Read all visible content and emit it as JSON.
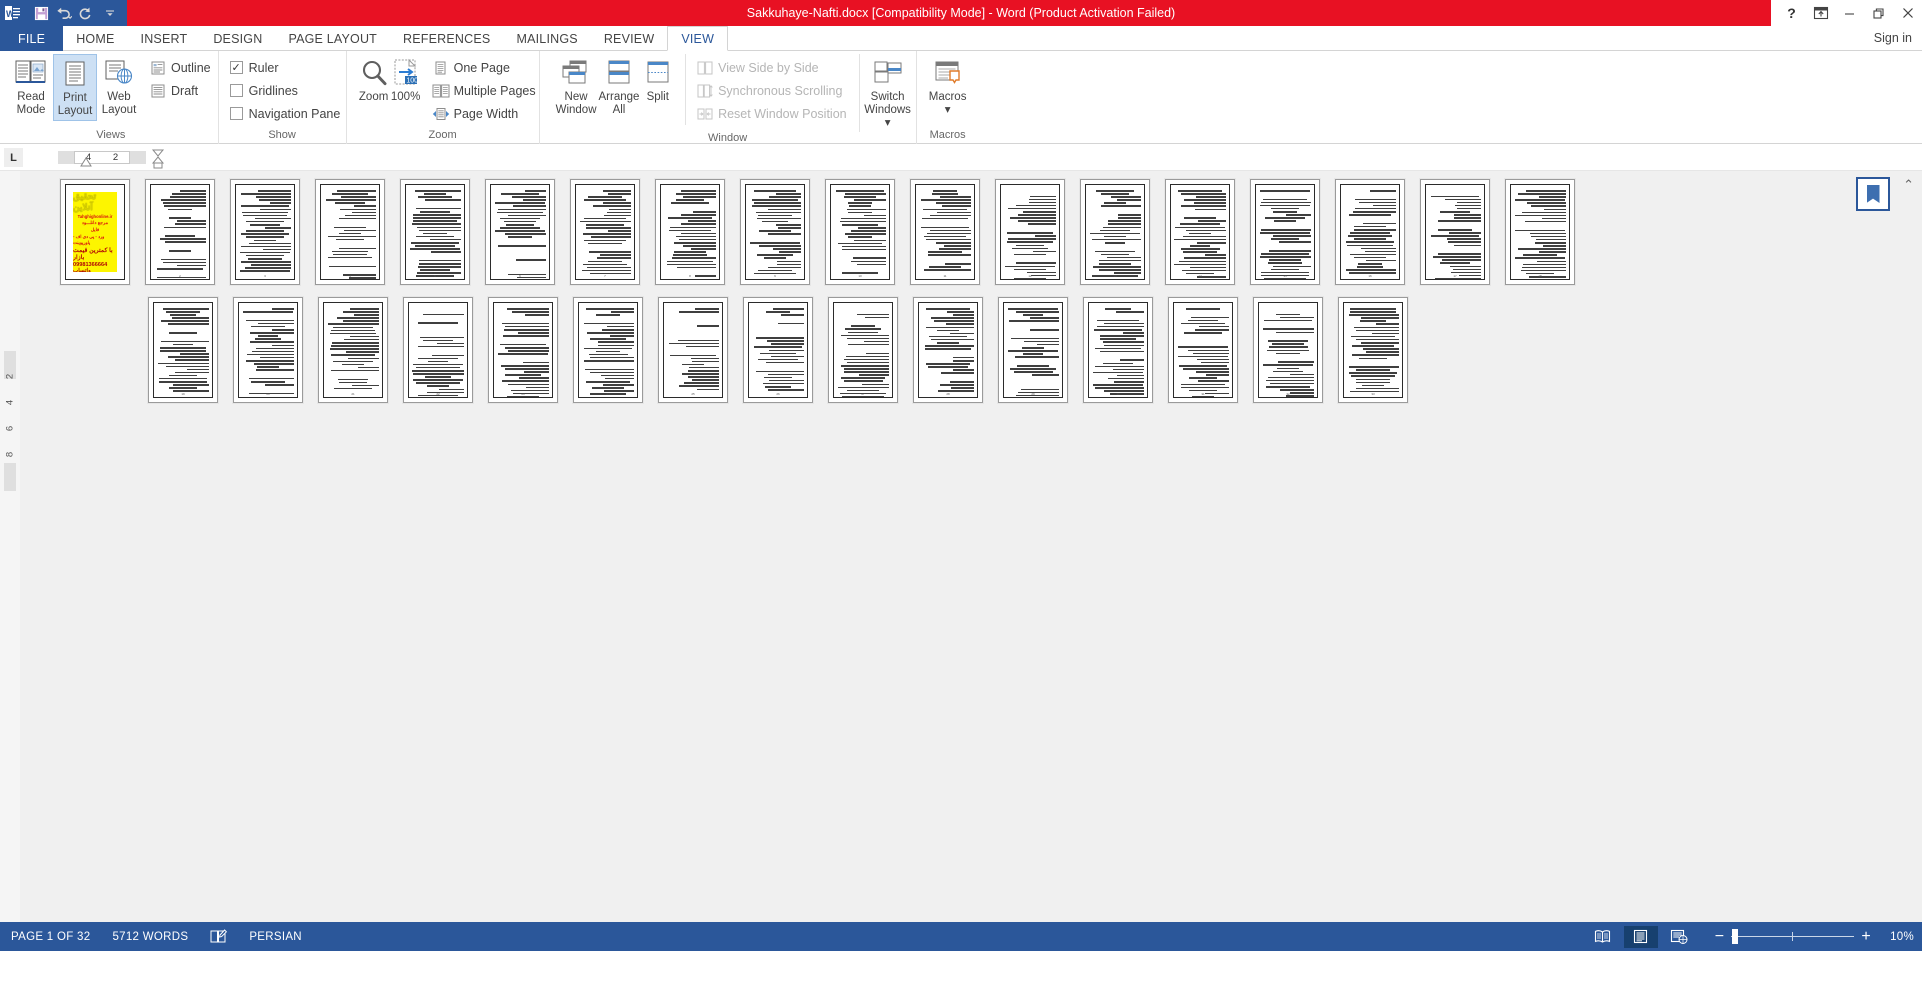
{
  "titlebar": {
    "document_title": "Sakkuhaye-Nafti.docx [Compatibility Mode]  -  Word (Product Activation Failed)",
    "accent_color": "#e81123",
    "quick_access": [
      {
        "name": "save-button",
        "label": "Save",
        "icon": "save-icon"
      },
      {
        "name": "undo-button",
        "label": "Undo",
        "icon": "undo-icon"
      },
      {
        "name": "redo-button",
        "label": "Redo",
        "icon": "redo-icon"
      },
      {
        "name": "customize-qat-button",
        "label": "Customize Quick Access Toolbar",
        "icon": "chevron-down-icon"
      }
    ],
    "window_controls": {
      "help": "?",
      "ribbon_display_options": "Ribbon Display Options",
      "minimize": "Minimize",
      "restore": "Restore Down",
      "close": "Close"
    }
  },
  "tabs": {
    "file_label": "FILE",
    "items": [
      {
        "label": "HOME",
        "active": false
      },
      {
        "label": "INSERT",
        "active": false
      },
      {
        "label": "DESIGN",
        "active": false
      },
      {
        "label": "PAGE LAYOUT",
        "active": false
      },
      {
        "label": "REFERENCES",
        "active": false
      },
      {
        "label": "MAILINGS",
        "active": false
      },
      {
        "label": "REVIEW",
        "active": false
      },
      {
        "label": "VIEW",
        "active": true
      }
    ],
    "sign_in": "Sign in"
  },
  "ribbon": {
    "groups": [
      {
        "name": "views",
        "label": "Views",
        "big_buttons": [
          {
            "label": "Read\nMode",
            "icon": "read-mode-icon",
            "selected": false
          },
          {
            "label": "Print\nLayout",
            "icon": "print-layout-icon",
            "selected": true
          },
          {
            "label": "Web\nLayout",
            "icon": "web-layout-icon",
            "selected": false
          }
        ],
        "small_items": [
          {
            "label": "Outline",
            "icon": "outline-icon",
            "disabled": false
          },
          {
            "label": "Draft",
            "icon": "draft-icon",
            "disabled": false
          }
        ]
      },
      {
        "name": "show",
        "label": "Show",
        "checkboxes": [
          {
            "label": "Ruler",
            "checked": true
          },
          {
            "label": "Gridlines",
            "checked": false
          },
          {
            "label": "Navigation Pane",
            "checked": false
          }
        ]
      },
      {
        "name": "zoom",
        "label": "Zoom",
        "big_buttons": [
          {
            "label": "Zoom",
            "icon": "magnifier-icon",
            "selected": false
          },
          {
            "label": "100%",
            "icon": "zoom-100-icon",
            "selected": false
          }
        ],
        "small_items": [
          {
            "label": "One Page",
            "icon": "one-page-icon",
            "disabled": false
          },
          {
            "label": "Multiple Pages",
            "icon": "multiple-pages-icon",
            "disabled": false
          },
          {
            "label": "Page Width",
            "icon": "page-width-icon",
            "disabled": false
          }
        ]
      },
      {
        "name": "window",
        "label": "Window",
        "big_buttons": [
          {
            "label": "New\nWindow",
            "icon": "new-window-icon",
            "selected": false
          },
          {
            "label": "Arrange\nAll",
            "icon": "arrange-all-icon",
            "selected": false
          },
          {
            "label": "Split",
            "icon": "split-icon",
            "selected": false
          },
          {
            "label": "Switch\nWindows ▾",
            "icon": "switch-windows-icon",
            "selected": false
          }
        ],
        "small_items": [
          {
            "label": "View Side by Side",
            "icon": "view-side-by-side-icon",
            "disabled": true
          },
          {
            "label": "Synchronous Scrolling",
            "icon": "synchronous-scrolling-icon",
            "disabled": true
          },
          {
            "label": "Reset Window Position",
            "icon": "reset-window-position-icon",
            "disabled": true
          }
        ]
      },
      {
        "name": "macros",
        "label": "Macros",
        "big_buttons": [
          {
            "label": "Macros\n▾",
            "icon": "macros-icon",
            "selected": false
          }
        ],
        "small_items": []
      }
    ]
  },
  "ruler": {
    "tab_stop_selector": "L",
    "marks": [
      "4",
      "2"
    ]
  },
  "vertical_ruler": {
    "marks": [
      "2",
      "4",
      "6",
      "8"
    ]
  },
  "document": {
    "bookmark_icon": "bookmark-icon",
    "collapse_ribbon_icon": "chevron-up-icon",
    "cover_page_ad": {
      "line1": "تحقیق آنلاین",
      "line2": "Tahghighonline.ir",
      "line3": "مرجع دانلـــود",
      "line4": "فایل",
      "line5": "ورد - پی دی اف - پاورپوینت",
      "line6": "با کمترین قیمت بازار",
      "line7": "09981366664 واتساب"
    },
    "row1_page_count": 18,
    "row2_page_count": 15
  },
  "statusbar": {
    "page_indicator": "PAGE 1 OF 32",
    "word_count": "5712 WORDS",
    "proofing_icon": "proofing-errors-icon",
    "language": "PERSIAN",
    "view_buttons": [
      {
        "name": "read-mode-view-button",
        "icon": "read-mode-view-icon",
        "selected": false
      },
      {
        "name": "print-layout-view-button",
        "icon": "print-layout-view-icon",
        "selected": true
      },
      {
        "name": "web-layout-view-button",
        "icon": "web-layout-view-icon",
        "selected": false
      }
    ],
    "zoom": {
      "minus": "−",
      "plus": "+",
      "value": "10%"
    },
    "accent_color": "#2b579a"
  }
}
